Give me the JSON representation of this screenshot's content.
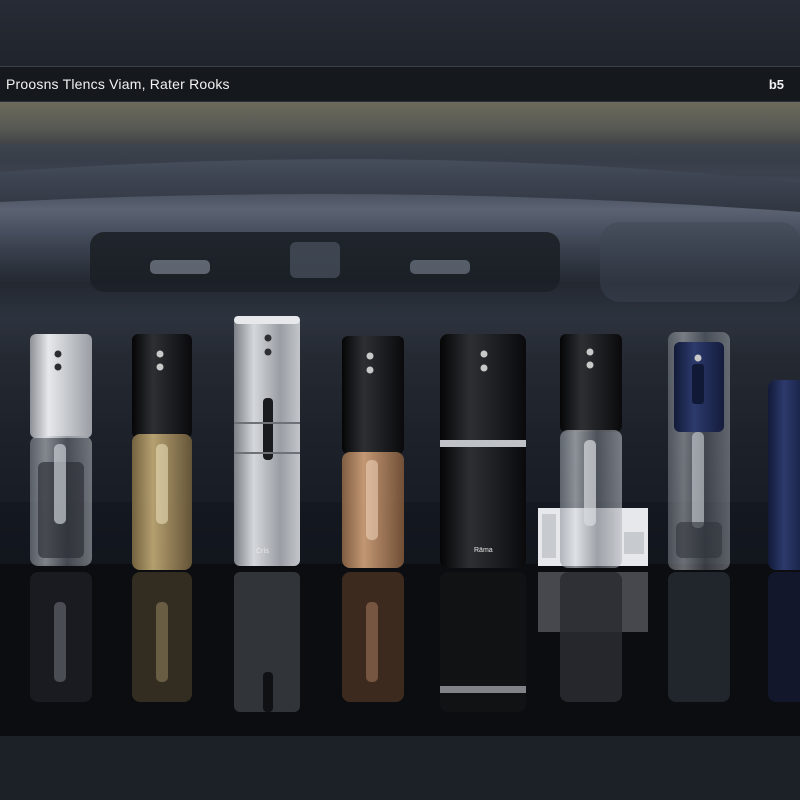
{
  "header": {
    "title": "Proosns Tlencs Viam, Rater Rooks",
    "badge": "b5"
  },
  "products": [
    {
      "id": "silver-clear",
      "body": "clear",
      "cap": "#b9bdc3"
    },
    {
      "id": "black-gold",
      "body": "gold",
      "cap": "#111214"
    },
    {
      "id": "steel-tall",
      "body": "steel",
      "cap": "#a7abb1"
    },
    {
      "id": "black-amber",
      "body": "amber",
      "cap": "#141518"
    },
    {
      "id": "matte-black-box",
      "body": "black",
      "cap": "#101113"
    },
    {
      "id": "black-clear",
      "body": "clear",
      "cap": "#121316"
    },
    {
      "id": "navy-clear",
      "body": "clear",
      "cap": "#1d2a52"
    },
    {
      "id": "navy-partial",
      "body": "navy",
      "cap": "#1a2346"
    }
  ]
}
